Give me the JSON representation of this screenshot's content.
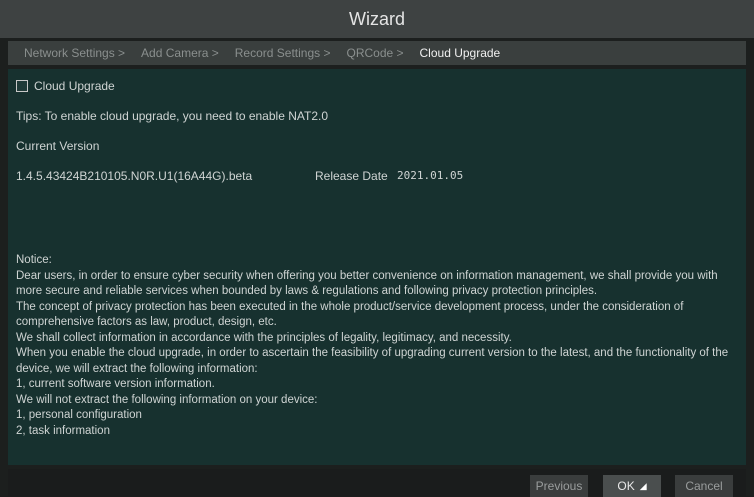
{
  "window": {
    "title": "Wizard"
  },
  "steps": [
    {
      "label": "Network Settings >"
    },
    {
      "label": "Add Camera >"
    },
    {
      "label": "Record Settings >"
    },
    {
      "label": "QRCode >"
    },
    {
      "label": "Cloud Upgrade",
      "active": true
    }
  ],
  "cloud_upgrade": {
    "checkbox_label": "Cloud Upgrade",
    "checked": false,
    "tips": "Tips: To enable cloud upgrade, you need to enable NAT2.0",
    "current_version_label": "Current Version",
    "version": "1.4.5.43424B210105.N0R.U1(16A44G).beta",
    "release_date_label": "Release Date",
    "release_date": "2021.01.05"
  },
  "notice": [
    "Notice:",
    "Dear users, in order to ensure cyber security when offering you better convenience on information management, we shall provide you with more secure and reliable services when bounded by laws & regulations and following privacy protection principles.",
    "The concept of privacy protection has been executed in the whole product/service development process, under the consideration of comprehensive factors as law, product, design, etc.",
    "We shall collect information in accordance with the principles of legality, legitimacy, and necessity.",
    "When you enable the cloud upgrade, in order to ascertain the feasibility of upgrading current version to the latest, and the functionality of the device, we will extract the following information:",
    "1, current software version information.",
    "We will not extract the following information on your device:",
    "1, personal configuration",
    "2, task information"
  ],
  "buttons": {
    "previous": "Previous",
    "ok": "OK",
    "cancel": "Cancel"
  },
  "icons": {
    "cursor": "mouse-pointer-icon"
  },
  "colors": {
    "panel": "#17312f",
    "titlebar": "#3e4242",
    "active_step": "#f0f0f0"
  }
}
